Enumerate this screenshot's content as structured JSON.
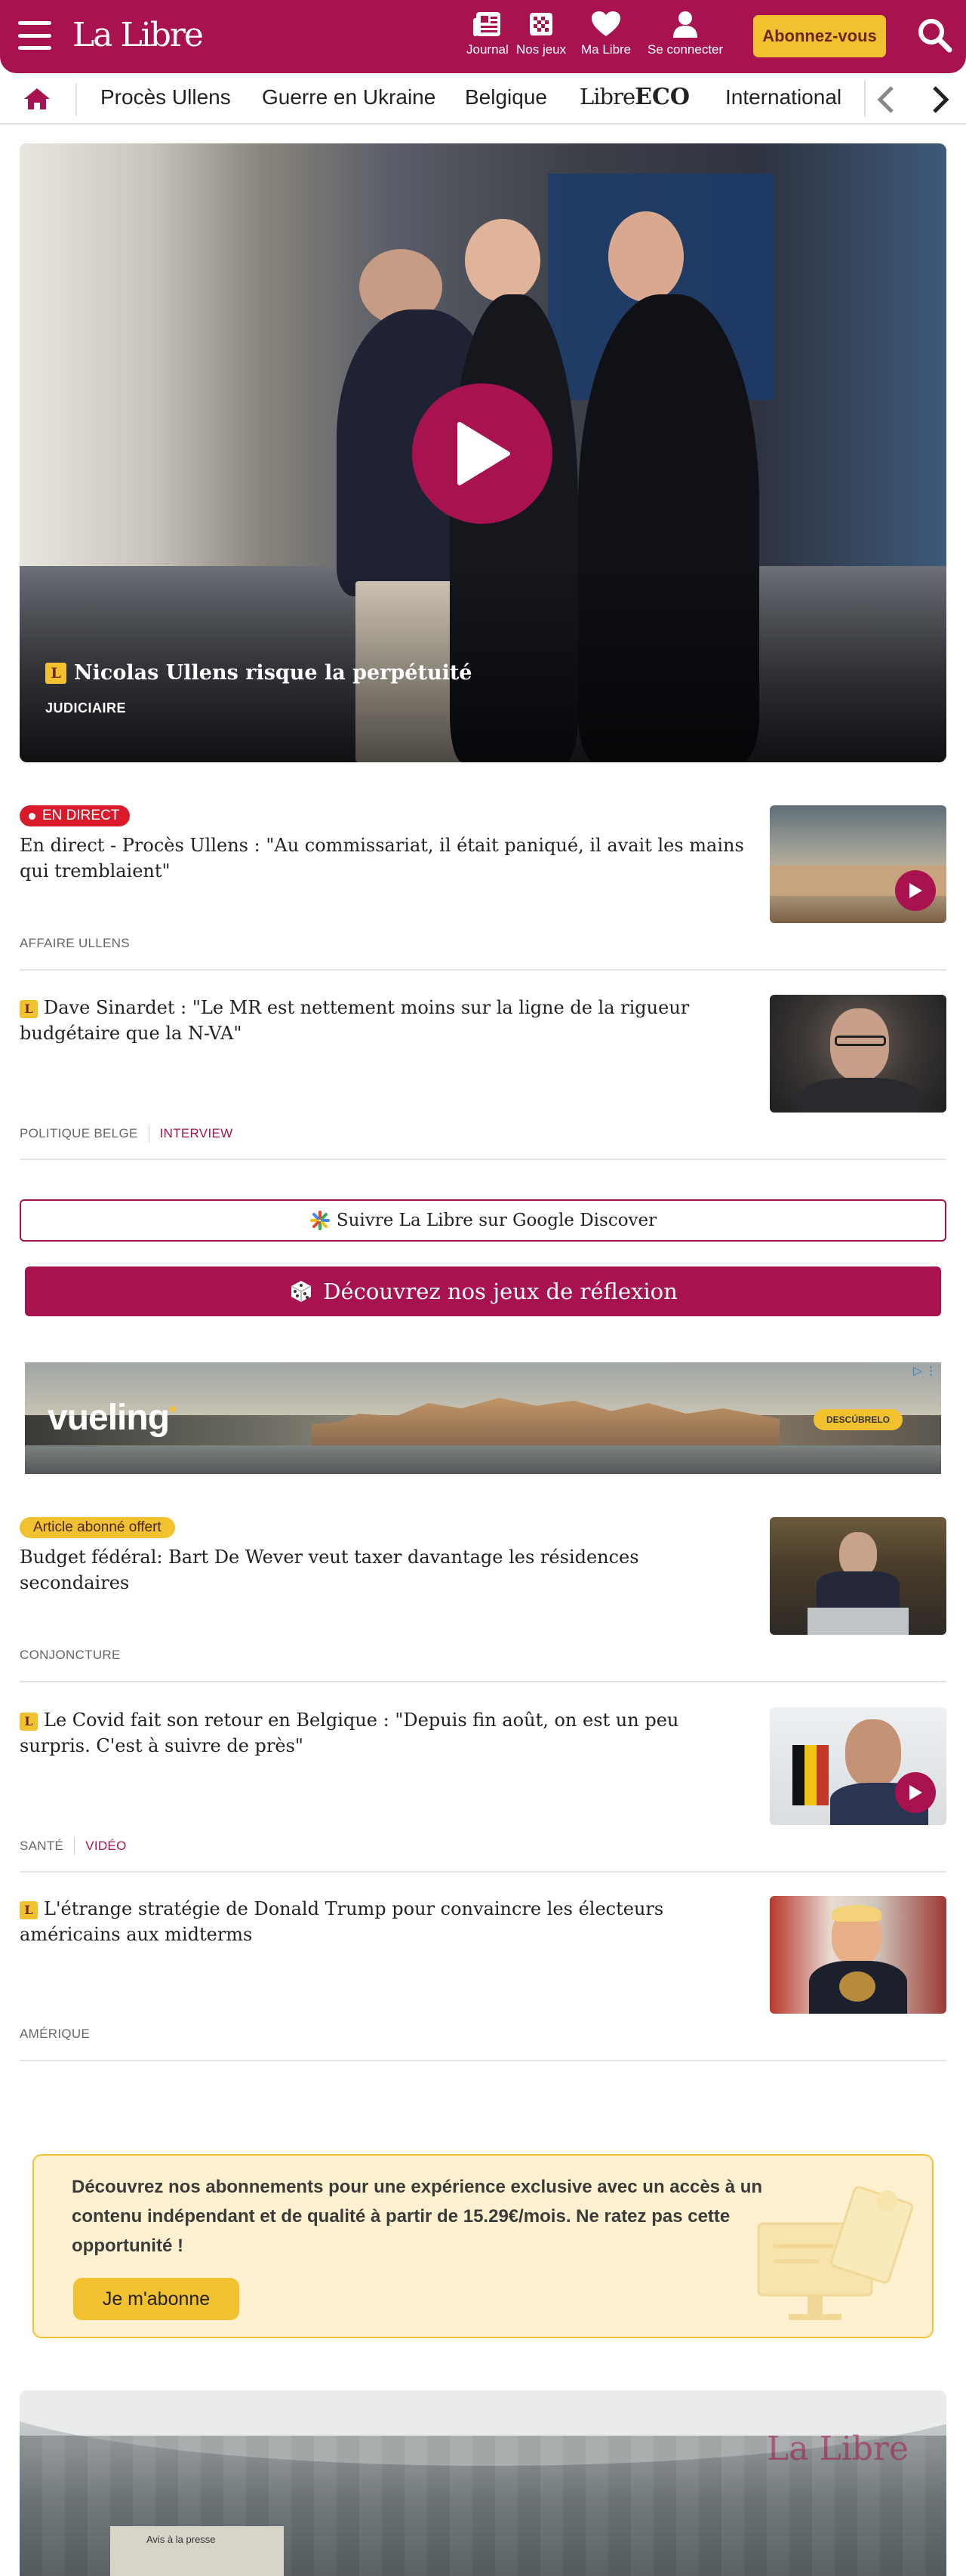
{
  "header": {
    "logo": "La Libre",
    "nav": [
      {
        "label": "Journal",
        "icon": "newspaper-icon"
      },
      {
        "label": "Nos jeux",
        "icon": "games-grid-icon"
      },
      {
        "label": "Ma Libre",
        "icon": "heart-icon"
      },
      {
        "label": "Se connecter",
        "icon": "user-icon"
      }
    ],
    "subscribe_label": "Abonnez-vous"
  },
  "sections": {
    "items": [
      "Procès Ullens",
      "Guerre en Ukraine",
      "Belgique",
      "International"
    ],
    "eco_logo_prefix": "Libre",
    "eco_logo_suffix": "ECO"
  },
  "hero": {
    "title": "Nicolas Ullens risque la perpétuité",
    "category": "JUDICIAIRE",
    "badge": "L"
  },
  "articles": [
    {
      "badge": "EN DIRECT",
      "title": "En direct - Procès Ullens : \"Au commissariat, il était paniqué, il avait les mains qui tremblaient\"",
      "meta": [
        "AFFAIRE ULLENS"
      ]
    },
    {
      "badge": "L",
      "title": "Dave Sinardet : \"Le MR est nettement moins sur la ligne de la rigueur budgétaire que la N-VA\"",
      "meta": [
        "POLITIQUE BELGE",
        "INTERVIEW"
      ]
    },
    {
      "badge": "Article abonné offert",
      "title": "Budget fédéral: Bart De Wever veut taxer davantage les résidences secondaires",
      "meta": [
        "CONJONCTURE"
      ]
    },
    {
      "badge": "L",
      "title": "Le Covid fait son retour en Belgique : \"Depuis fin août, on est un peu surpris. C'est à suivre de près\"",
      "meta": [
        "SANTÉ",
        "VIDÉO"
      ]
    },
    {
      "badge": "L",
      "title": "L'étrange stratégie de Donald Trump pour convaincre les électeurs américains aux midterms",
      "meta": [
        "AMÉRIQUE"
      ]
    }
  ],
  "google_discover": "Suivre La Libre sur Google Discover",
  "games_button": "Découvrez nos jeux de réflexion",
  "ad": {
    "brand": "vueling",
    "cta": "DESCÚBRELO"
  },
  "subscription": {
    "text": "Découvrez nos abonnements pour une expérience exclusive avec un accès à un contenu indépendant et de qualité à partir de 15.29€/mois. Ne ratez pas cette opportunité !",
    "button": "Je m'abonne"
  },
  "bottom_image": {
    "watermark": "La Libre",
    "sign": "Avis à la presse"
  },
  "colors": {
    "brand": "#a8134f",
    "accent_yellow": "#f2c130",
    "live_red": "#d81a2a"
  }
}
